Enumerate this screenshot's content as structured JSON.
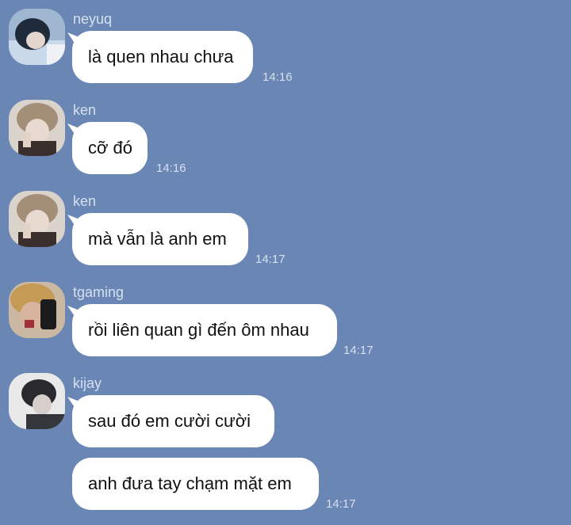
{
  "messages": [
    {
      "sender": "neyuq",
      "text": "là quen nhau chưa",
      "time": "14:16"
    },
    {
      "sender": "ken",
      "text": "cỡ đó",
      "time": "14:16"
    },
    {
      "sender": "ken",
      "text": "mà vẫn là anh em",
      "time": "14:17"
    },
    {
      "sender": "tgaming",
      "text": "rồi liên quan gì đến ôm nhau",
      "time": "14:17"
    },
    {
      "sender": "kijay",
      "text": "sau đó em cười cười",
      "time": ""
    },
    {
      "sender": "",
      "text": "anh đưa tay chạm mặt em",
      "time": "14:17"
    }
  ],
  "avatars": [
    {
      "name": "neyuq-avatar-photo"
    },
    {
      "name": "ken-avatar-photo"
    },
    {
      "name": "ken-avatar-photo"
    },
    {
      "name": "tgaming-avatar-photo"
    },
    {
      "name": "kijay-avatar-photo"
    }
  ],
  "colors": {
    "background": "#6a86b4",
    "bubble": "#ffffff",
    "meta_text": "#d6e0ef"
  }
}
